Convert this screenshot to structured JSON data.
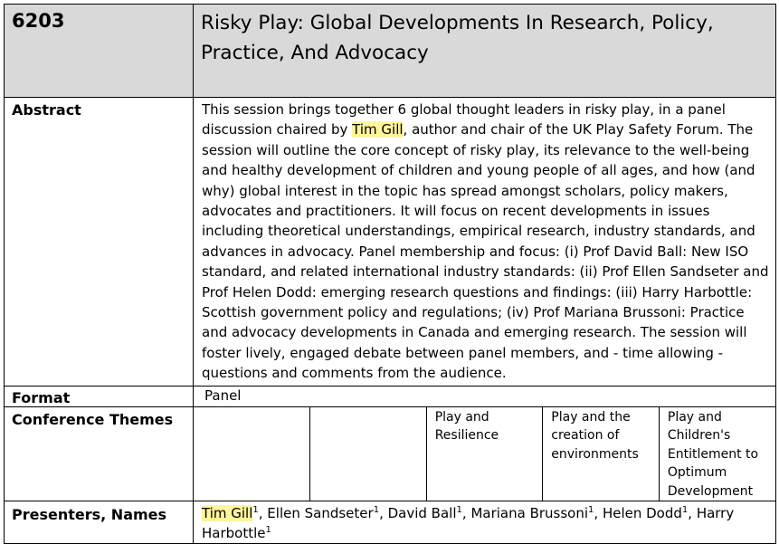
{
  "header": {
    "id": "6203",
    "title": "Risky Play: Global Developments In Research, Policy, Practice, And Advocacy"
  },
  "abstract": {
    "label": "Abstract",
    "before": "This session brings together 6 global thought leaders in risky play, in a panel discussion chaired by ",
    "highlight": "Tim Gill",
    "after": ", author and chair of the UK Play Safety Forum. The session will outline the core concept of risky play, its relevance to the well-being and healthy development of children and young people of all ages, and how (and why) global interest in the topic has spread amongst scholars, policy makers, advocates and practitioners. It will focus on recent developments in issues including theoretical understandings, empirical research, industry standards, and advances in advocacy. Panel membership and focus: (i) Prof David Ball: New ISO standard, and related international industry standards: (ii) Prof Ellen Sandseter and Prof Helen Dodd: emerging research questions and findings: (iii) Harry Harbottle: Scottish government policy and regulations; (iv) Prof Mariana Brussoni: Practice and advocacy developments in Canada and emerging research. The session will foster lively, engaged debate between panel members, and - time allowing - questions and comments from the audience."
  },
  "format": {
    "label": "Format",
    "value": "Panel"
  },
  "themes": {
    "label": "Conference Themes",
    "cells": [
      "",
      "",
      "Play and Resilience",
      "Play and the creation of environments",
      "Play and Children's Entitlement to Optimum Development"
    ]
  },
  "presenters": {
    "label": "Presenters, Names",
    "list": [
      {
        "name": "Tim Gill",
        "sup": "1",
        "highlight": true,
        "sep": ", "
      },
      {
        "name": "Ellen Sandseter",
        "sup": "1",
        "highlight": false,
        "sep": ", "
      },
      {
        "name": "David Ball",
        "sup": "1",
        "highlight": false,
        "sep": ", "
      },
      {
        "name": "Mariana Brussoni",
        "sup": "1",
        "highlight": false,
        "sep": ", "
      },
      {
        "name": "Helen Dodd",
        "sup": "1",
        "highlight": false,
        "sep": ", "
      },
      {
        "name": "Harry Harbottle",
        "sup": "1",
        "highlight": false,
        "sep": ""
      }
    ]
  }
}
